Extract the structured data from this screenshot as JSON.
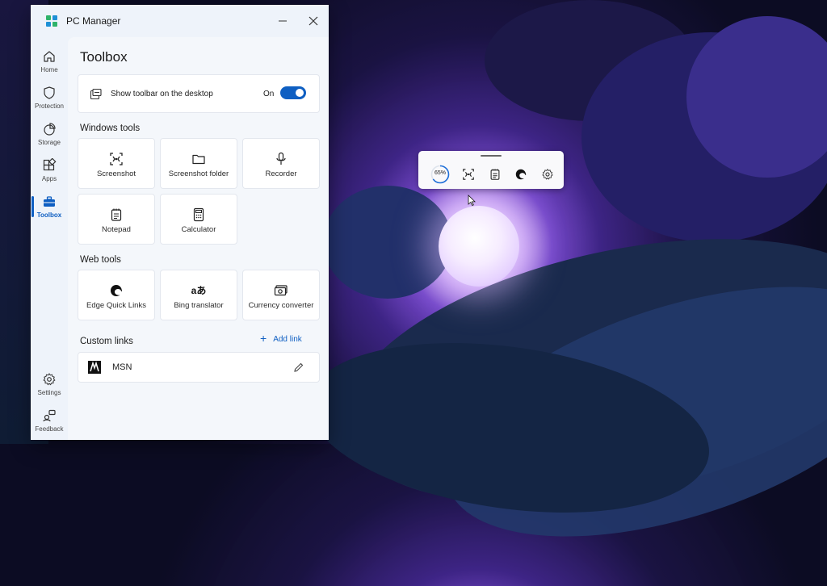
{
  "window": {
    "title": "PC Manager",
    "minimize_label": "—",
    "close_label": "✕"
  },
  "nav": {
    "items": [
      {
        "label": "Home",
        "icon": "home-icon"
      },
      {
        "label": "Protection",
        "icon": "shield-icon"
      },
      {
        "label": "Storage",
        "icon": "pie-chart-icon"
      },
      {
        "label": "Apps",
        "icon": "apps-grid-icon"
      },
      {
        "label": "Toolbox",
        "icon": "toolbox-icon",
        "active": true
      }
    ],
    "bottom": [
      {
        "label": "Settings",
        "icon": "gear-icon"
      },
      {
        "label": "Feedback",
        "icon": "feedback-icon"
      }
    ]
  },
  "toolbox": {
    "title": "Toolbox",
    "toolbar_option": {
      "label": "Show toolbar on the desktop",
      "state": "On",
      "enabled": true
    },
    "windows_tools": {
      "heading": "Windows tools",
      "items": [
        {
          "label": "Screenshot",
          "icon": "screenshot-icon"
        },
        {
          "label": "Screenshot folder",
          "icon": "folder-icon"
        },
        {
          "label": "Recorder",
          "icon": "microphone-icon"
        },
        {
          "label": "Notepad",
          "icon": "notepad-icon"
        },
        {
          "label": "Calculator",
          "icon": "calculator-icon"
        }
      ]
    },
    "web_tools": {
      "heading": "Web tools",
      "items": [
        {
          "label": "Edge Quick Links",
          "icon": "edge-icon"
        },
        {
          "label": "Bing translator",
          "icon": "translate-icon",
          "glyph": "aあ"
        },
        {
          "label": "Currency converter",
          "icon": "currency-icon"
        }
      ]
    },
    "custom_links": {
      "heading": "Custom links",
      "add_label": "Add link",
      "add_glyph": "+",
      "items": [
        {
          "label": "MSN",
          "icon": "msn-icon"
        }
      ]
    }
  },
  "floating_toolbar": {
    "memory_percent_text": "65%",
    "memory_fraction": 0.65,
    "accent": "#1e6fd9",
    "icons": [
      "screenshot-icon",
      "notepad-icon",
      "edge-icon",
      "gear-icon"
    ]
  },
  "colors": {
    "accent": "#0f5fc2"
  }
}
